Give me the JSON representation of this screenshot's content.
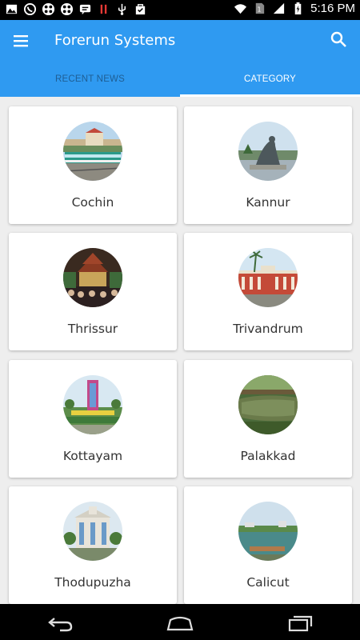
{
  "status_bar": {
    "time": "5:16 PM",
    "left_icons": [
      "image-icon",
      "whatsapp-icon",
      "game-icon",
      "game-icon",
      "message-icon",
      "pause-icon",
      "usb-icon",
      "bag-icon"
    ],
    "right_icons": [
      "wifi-icon",
      "sim-icon",
      "signal-icon",
      "battery-icon"
    ]
  },
  "app_bar": {
    "title": "Forerun Systems",
    "menu_icon": "menu-icon",
    "search_icon": "search-icon",
    "color": "#2f9af1"
  },
  "tabs": [
    {
      "label": "RECENT NEWS",
      "active": false
    },
    {
      "label": "CATEGORY",
      "active": true
    }
  ],
  "categories": [
    {
      "label": "Cochin",
      "image": "train-photo"
    },
    {
      "label": "Kannur",
      "image": "statue-photo"
    },
    {
      "label": "Thrissur",
      "image": "temple-festival-photo"
    },
    {
      "label": "Trivandrum",
      "image": "government-building-photo"
    },
    {
      "label": "Kottayam",
      "image": "monument-garden-photo"
    },
    {
      "label": "Palakkad",
      "image": "fort-moat-photo"
    },
    {
      "label": "Thodupuzha",
      "image": "church-building-photo"
    },
    {
      "label": "Calicut",
      "image": "lake-photo"
    }
  ],
  "nav_bar": {
    "buttons": [
      "back-icon",
      "home-icon",
      "recent-apps-icon"
    ]
  }
}
